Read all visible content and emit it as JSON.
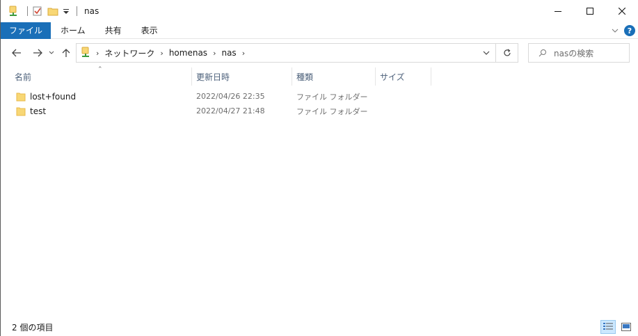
{
  "window": {
    "title": "nas"
  },
  "ribbon": {
    "tabs": [
      "ファイル",
      "ホーム",
      "共有",
      "表示"
    ],
    "help": "?"
  },
  "address": {
    "breadcrumbs": [
      "ネットワーク",
      "homenas",
      "nas"
    ],
    "search_placeholder": "nasの検索"
  },
  "columns": {
    "name": "名前",
    "date": "更新日時",
    "type": "種類",
    "size": "サイズ"
  },
  "files": [
    {
      "name": "lost+found",
      "date": "2022/04/26 22:35",
      "type": "ファイル フォルダー"
    },
    {
      "name": "test",
      "date": "2022/04/27 21:48",
      "type": "ファイル フォルダー"
    }
  ],
  "status": {
    "item_count": "2 個の項目"
  },
  "colors": {
    "accent": "#1a6fb8",
    "folder": "#f8d775",
    "folder_dark": "#e8b94a"
  }
}
